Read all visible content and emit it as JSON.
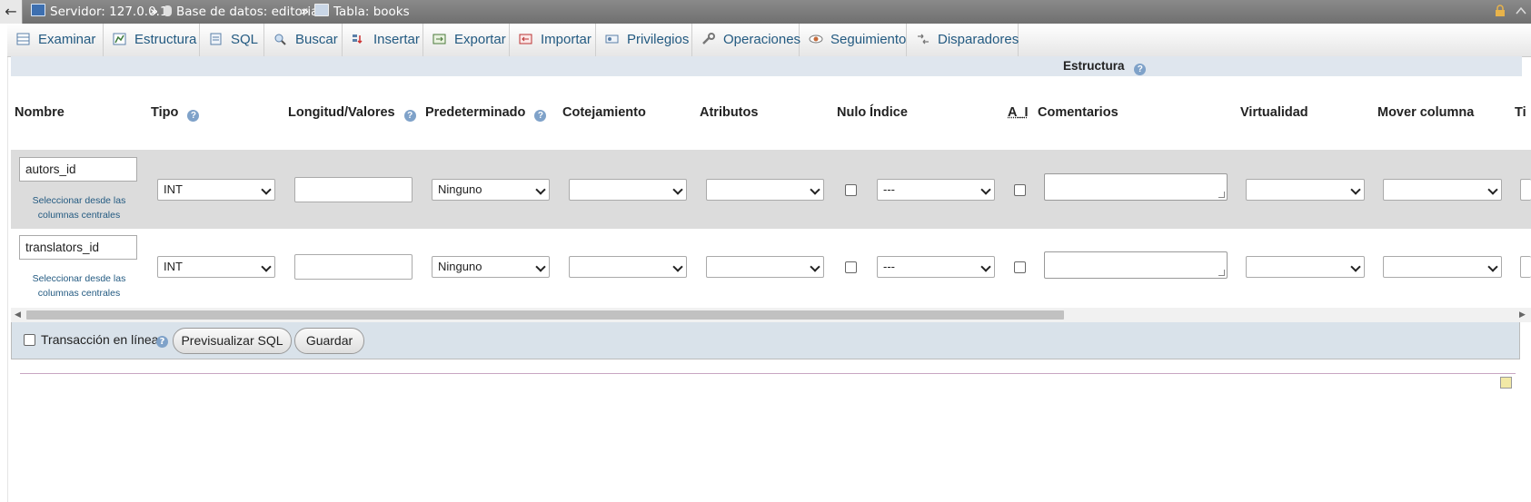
{
  "breadcrumb": {
    "back_icon": "←",
    "server": "Servidor: 127.0.0.1",
    "database": "Base de datos: editorial",
    "table": "Tabla: books",
    "separator": "»"
  },
  "tabs": [
    {
      "label": "Examinar",
      "icon": "browse-icon"
    },
    {
      "label": "Estructura",
      "icon": "structure-icon"
    },
    {
      "label": "SQL",
      "icon": "sql-icon"
    },
    {
      "label": "Buscar",
      "icon": "search-icon"
    },
    {
      "label": "Insertar",
      "icon": "insert-icon"
    },
    {
      "label": "Exportar",
      "icon": "export-icon"
    },
    {
      "label": "Importar",
      "icon": "import-icon"
    },
    {
      "label": "Privilegios",
      "icon": "privileges-icon"
    },
    {
      "label": "Operaciones",
      "icon": "operations-icon"
    },
    {
      "label": "Seguimiento",
      "icon": "tracking-icon"
    },
    {
      "label": "Disparadores",
      "icon": "triggers-icon"
    }
  ],
  "structure_title": "Estructura",
  "columns": {
    "nombre": "Nombre",
    "tipo": "Tipo",
    "longitud": "Longitud/Valores",
    "predeterminado": "Predeterminado",
    "cotejamiento": "Cotejamiento",
    "atributos": "Atributos",
    "nulo": "Nulo",
    "indice": "Índice",
    "ai": "A_I",
    "comentarios": "Comentarios",
    "virtualidad": "Virtualidad",
    "mover": "Mover columna",
    "ti": "Ti"
  },
  "rows": [
    {
      "name": "autors_id",
      "type": "INT",
      "length": "",
      "default": "Ninguno",
      "collation": "",
      "attributes": "",
      "null": false,
      "index": "---",
      "ai": false,
      "comment": "",
      "virtuality": "",
      "move": "",
      "central_line1": "Seleccionar desde las",
      "central_line2": "columnas centrales"
    },
    {
      "name": "translators_id",
      "type": "INT",
      "length": "",
      "default": "Ninguno",
      "collation": "",
      "attributes": "",
      "null": false,
      "index": "---",
      "ai": false,
      "comment": "",
      "virtuality": "",
      "move": "",
      "central_line1": "Seleccionar desde las",
      "central_line2": "columnas centrales"
    }
  ],
  "footer": {
    "online_transaction_label": "Transacción en línea",
    "preview_sql_button": "Previsualizar SQL",
    "save_button": "Guardar"
  },
  "help_glyph": "?",
  "colors": {
    "topbar": "#777777",
    "link": "#235a81",
    "row_alt": "#dcdcdc",
    "footer_band": "#d9e2ea"
  }
}
